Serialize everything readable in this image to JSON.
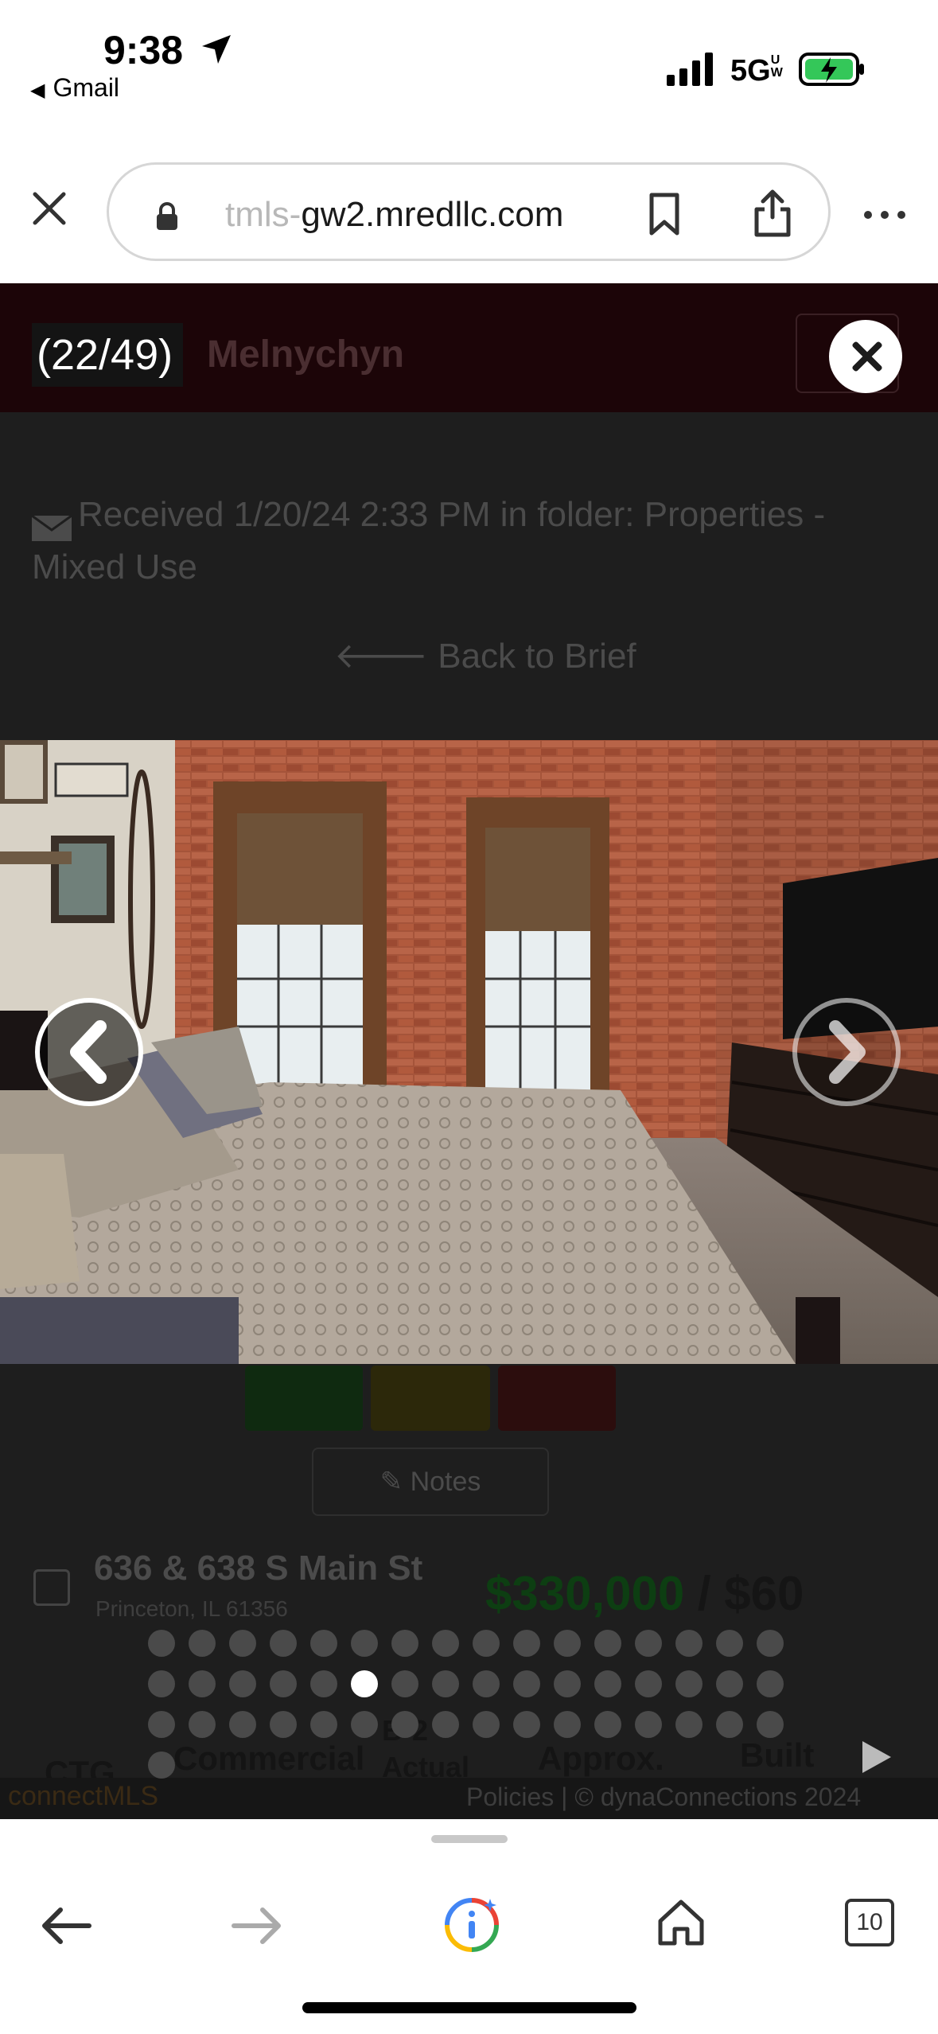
{
  "status_bar": {
    "time": "9:38",
    "back_app": "Gmail",
    "network": "5G",
    "network_superscript": "UW"
  },
  "browser": {
    "url_prefix_faded": "tmls-",
    "url_main": "gw2.mredllc.com"
  },
  "listing": {
    "agent_name_partial": "Melnychyn",
    "received_text": "Received 1/20/24 2:33 PM in folder: Properties - Mixed Use",
    "back_link": "Back to Brief",
    "notes_label": "Notes",
    "address": "636 & 638 S Main St",
    "city": "Princeton, IL 61356",
    "price": "$330,000",
    "price_rest": " / $60",
    "categories": [
      "CTG",
      "Commercial",
      "B-2 Actual",
      "Approx.",
      "Built"
    ]
  },
  "footer": {
    "logo": "connectMLS",
    "policies": "Policies | © dynaConnections 2024"
  },
  "gallery": {
    "counter": "(22/49)",
    "current_index": 22,
    "total": 49
  },
  "bottom_nav": {
    "tab_count": "10"
  },
  "colors": {
    "header_maroon": "#1c0508",
    "dim_bg": "#1e1e1e",
    "price_green": "#0d3e12"
  }
}
